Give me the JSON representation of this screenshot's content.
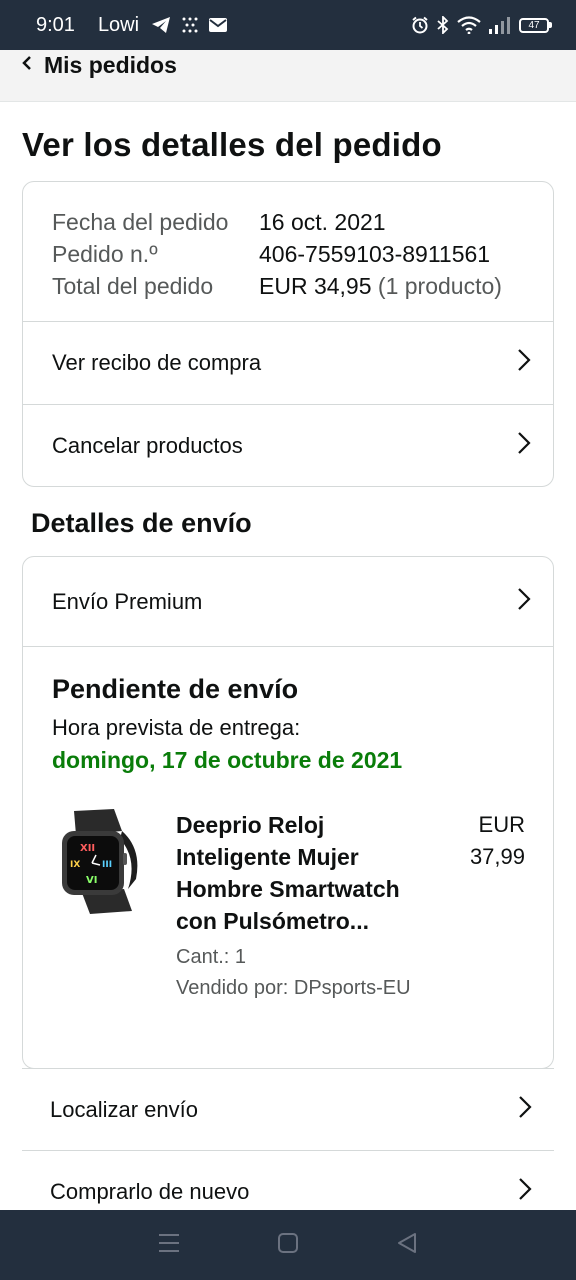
{
  "status_bar": {
    "time": "9:01",
    "carrier": "Lowi",
    "battery": "47",
    "icons": [
      "telegram-icon",
      "dots-icon",
      "mail-icon",
      "alarm-icon",
      "bluetooth-icon",
      "wifi-icon",
      "signal-icon",
      "battery-icon"
    ]
  },
  "header": {
    "back_label": "Mis pedidos"
  },
  "page_title": "Ver los detalles del pedido",
  "order": {
    "date_label": "Fecha del pedido",
    "date_value": "16 oct. 2021",
    "number_label": "Pedido n.º",
    "number_value": "406-7559103-8911561",
    "total_label": "Total del pedido",
    "total_value": "EUR 34,95",
    "total_note": "(1 producto)"
  },
  "order_links": {
    "receipt": "Ver recibo de compra",
    "cancel": "Cancelar productos"
  },
  "shipping": {
    "section_title": "Detalles de envío",
    "method": "Envío Premium",
    "status": "Pendiente de envío",
    "delivery_label": "Hora prevista de entrega:",
    "delivery_date": "domingo, 17 de octubre de 2021"
  },
  "product": {
    "name": "Deeprio Reloj Inteligente Mujer Hombre Smartwatch con Pulsómetro...",
    "currency": "EUR",
    "price": "37,99",
    "quantity": "Cant.: 1",
    "seller": "Vendido por: DPsports-EU"
  },
  "bottom_links": {
    "track": "Localizar envío",
    "buy_again": "Comprarlo de nuevo"
  },
  "colors": {
    "status_bar": "#232f3e",
    "delivery_green": "#0a7d0a"
  }
}
